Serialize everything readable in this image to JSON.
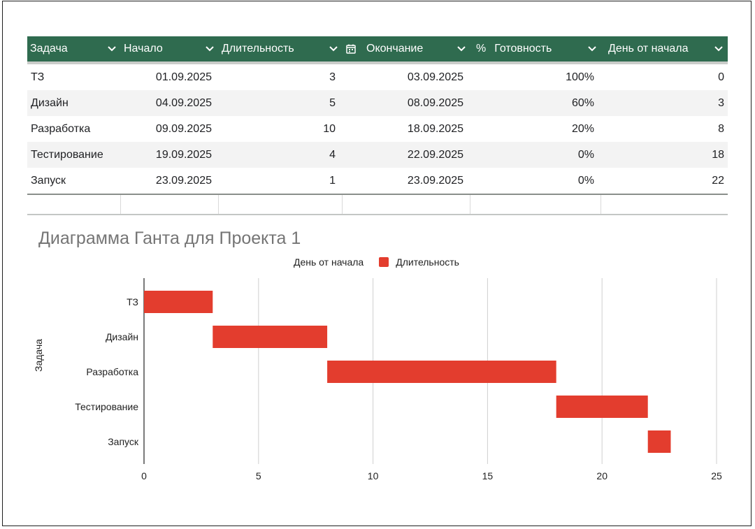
{
  "table": {
    "headers": [
      {
        "label": "Задача",
        "icon": ""
      },
      {
        "label": "Начало",
        "icon": ""
      },
      {
        "label": "Длительность",
        "icon": ""
      },
      {
        "label": "Окончание",
        "icon": "calendar-icon"
      },
      {
        "label": "Готовность",
        "icon": "percent-icon",
        "prefix": "%"
      },
      {
        "label": "День от начала",
        "icon": ""
      }
    ],
    "rows": [
      [
        "ТЗ",
        "01.09.2025",
        "3",
        "03.09.2025",
        "100%",
        "0"
      ],
      [
        "Дизайн",
        "04.09.2025",
        "5",
        "08.09.2025",
        "60%",
        "3"
      ],
      [
        "Разработка",
        "09.09.2025",
        "10",
        "18.09.2025",
        "20%",
        "8"
      ],
      [
        "Тестирование",
        "19.09.2025",
        "4",
        "22.09.2025",
        "0%",
        "18"
      ],
      [
        "Запуск",
        "23.09.2025",
        "1",
        "23.09.2025",
        "0%",
        "22"
      ]
    ],
    "header_bg": "#2f6b4f"
  },
  "chart_data": {
    "type": "bar",
    "orientation": "horizontal",
    "stacked": true,
    "title": "Диаграмма Ганта для Проекта 1",
    "xlabel": "",
    "ylabel": "Задача",
    "categories": [
      "ТЗ",
      "Дизайн",
      "Разработка",
      "Тестирование",
      "Запуск"
    ],
    "series": [
      {
        "name": "День от начала",
        "values": [
          0,
          3,
          8,
          18,
          22
        ],
        "color": "transparent"
      },
      {
        "name": "Длительность",
        "values": [
          3,
          5,
          10,
          4,
          1
        ],
        "color": "#e33d2e"
      }
    ],
    "xlim": [
      0,
      25
    ],
    "xticks": [
      "0",
      "5",
      "10",
      "15",
      "20",
      "25"
    ],
    "grid": true,
    "legend": "top"
  }
}
